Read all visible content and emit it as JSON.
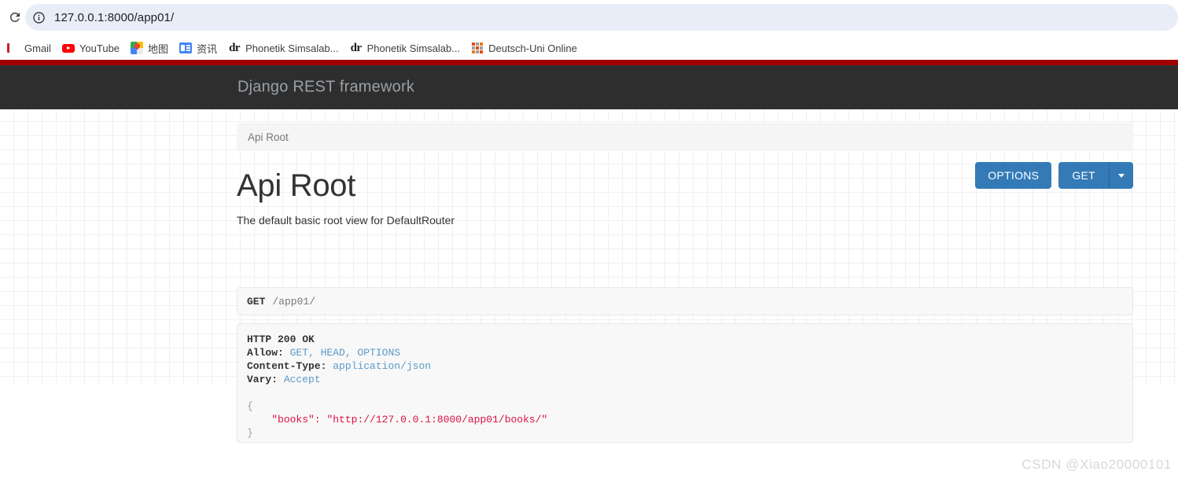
{
  "browser": {
    "reload_icon": "reload-icon",
    "site_info_icon": "info-circle-icon",
    "url": "127.0.0.1:8000/app01/",
    "url_placeholder": "Search Google or type a URL",
    "bookmarks": [
      {
        "label": "Gmail",
        "icon": "gmail-icon"
      },
      {
        "label": "YouTube",
        "icon": "youtube-icon"
      },
      {
        "label": "地图",
        "icon": "google-maps-icon"
      },
      {
        "label": "资讯",
        "icon": "google-news-icon"
      },
      {
        "label": "Phonetik Simsalab...",
        "icon": "dr-icon"
      },
      {
        "label": "Phonetik Simsalab...",
        "icon": "dr-icon"
      },
      {
        "label": "Deutsch-Uni Online",
        "icon": "grid-squares-icon"
      }
    ]
  },
  "navbar": {
    "brand": "Django REST framework",
    "accent_color": "#a30000",
    "background_color": "#2e2e2e"
  },
  "breadcrumb": {
    "items": [
      "Api Root"
    ]
  },
  "main": {
    "title": "Api Root",
    "subtitle": "The default basic root view for DefaultRouter",
    "buttons": {
      "options_label": "OPTIONS",
      "get_label": "GET",
      "caret_icon": "chevron-down-icon",
      "color": "#337ab7"
    },
    "request": {
      "method": "GET",
      "path": "/app01/"
    },
    "response": {
      "status_line": "HTTP 200 OK",
      "headers": [
        {
          "name": "Allow:",
          "value": "GET, HEAD, OPTIONS"
        },
        {
          "name": "Content-Type:",
          "value": "application/json"
        },
        {
          "name": "Vary:",
          "value": "Accept"
        }
      ],
      "body": {
        "open_brace": "{",
        "close_brace": "}",
        "indent": "    ",
        "key": "\"books\":",
        "value": "\"http://127.0.0.1:8000/app01/books/\""
      }
    }
  },
  "watermark": "CSDN @Xiao20000101"
}
